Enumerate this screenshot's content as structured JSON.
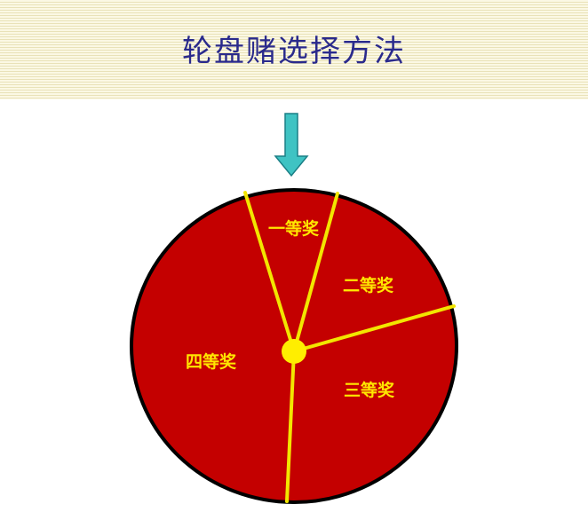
{
  "title": "轮盘赌选择方法",
  "wheel": {
    "fill_color": "#c40000",
    "divider_color": "#f2e600",
    "outline_color": "#000000",
    "hub_color": "#ffee00",
    "pointer_color": "#3fc3c3",
    "sectors": [
      {
        "label": "一等奖"
      },
      {
        "label": "二等奖"
      },
      {
        "label": "三等奖"
      },
      {
        "label": "四等奖"
      }
    ]
  }
}
